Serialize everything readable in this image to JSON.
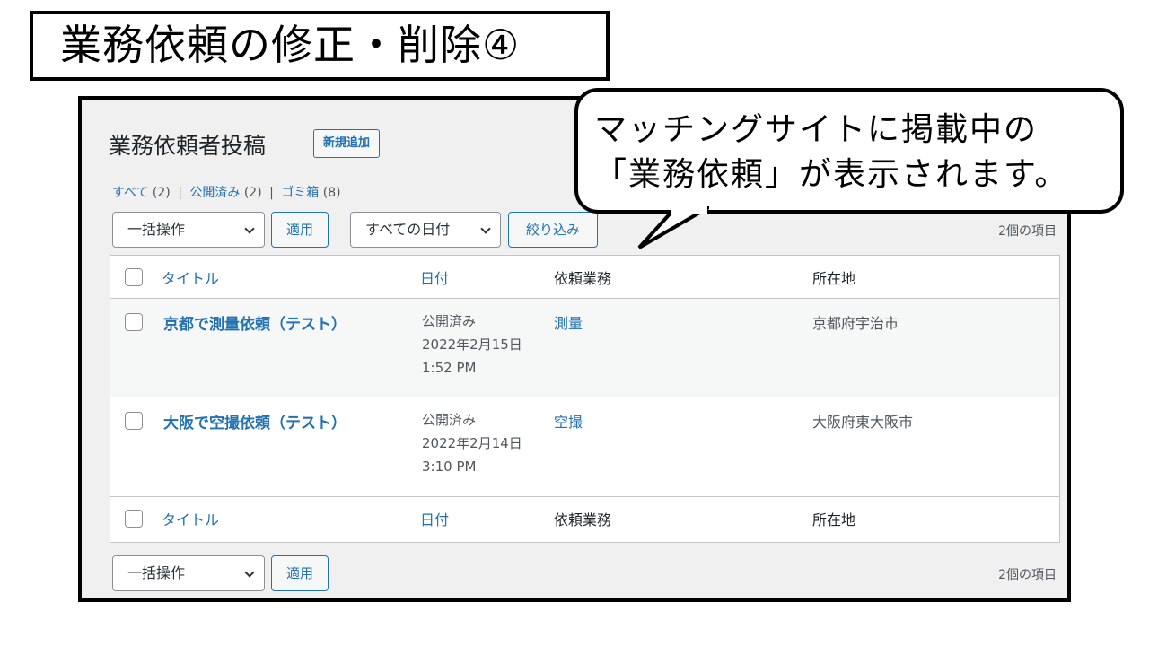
{
  "slide": {
    "title": "業務依頼の修正・削除④"
  },
  "callout": {
    "line1": "マッチングサイトに掲載中の",
    "line2": "「業務依頼」が表示されます。"
  },
  "page": {
    "title": "業務依頼者投稿",
    "add_new": "新規追加"
  },
  "filters": {
    "all_label": "すべて",
    "all_count": "(2)",
    "published_label": "公開済み",
    "published_count": "(2)",
    "trash_label": "ゴミ箱",
    "trash_count": "(8)",
    "separator": "|"
  },
  "toolbar": {
    "bulk_action": "一括操作",
    "apply": "適用",
    "all_dates": "すべての日付",
    "filter": "絞り込み",
    "items_count": "2個の項目"
  },
  "table": {
    "columns": [
      "タイトル",
      "日付",
      "依頼業務",
      "所在地"
    ],
    "rows": [
      {
        "title": "京都で測量依頼（テスト）",
        "status": "公開済み",
        "date": "2022年2月15日",
        "time": "1:52 PM",
        "service": "測量",
        "location": "京都府宇治市"
      },
      {
        "title": "大阪で空撮依頼（テスト）",
        "status": "公開済み",
        "date": "2022年2月14日",
        "time": "3:10 PM",
        "service": "空撮",
        "location": "大阪府東大阪市"
      }
    ]
  },
  "bottom_toolbar": {
    "bulk_action": "一括操作",
    "apply": "適用",
    "items_count": "2個の項目"
  }
}
